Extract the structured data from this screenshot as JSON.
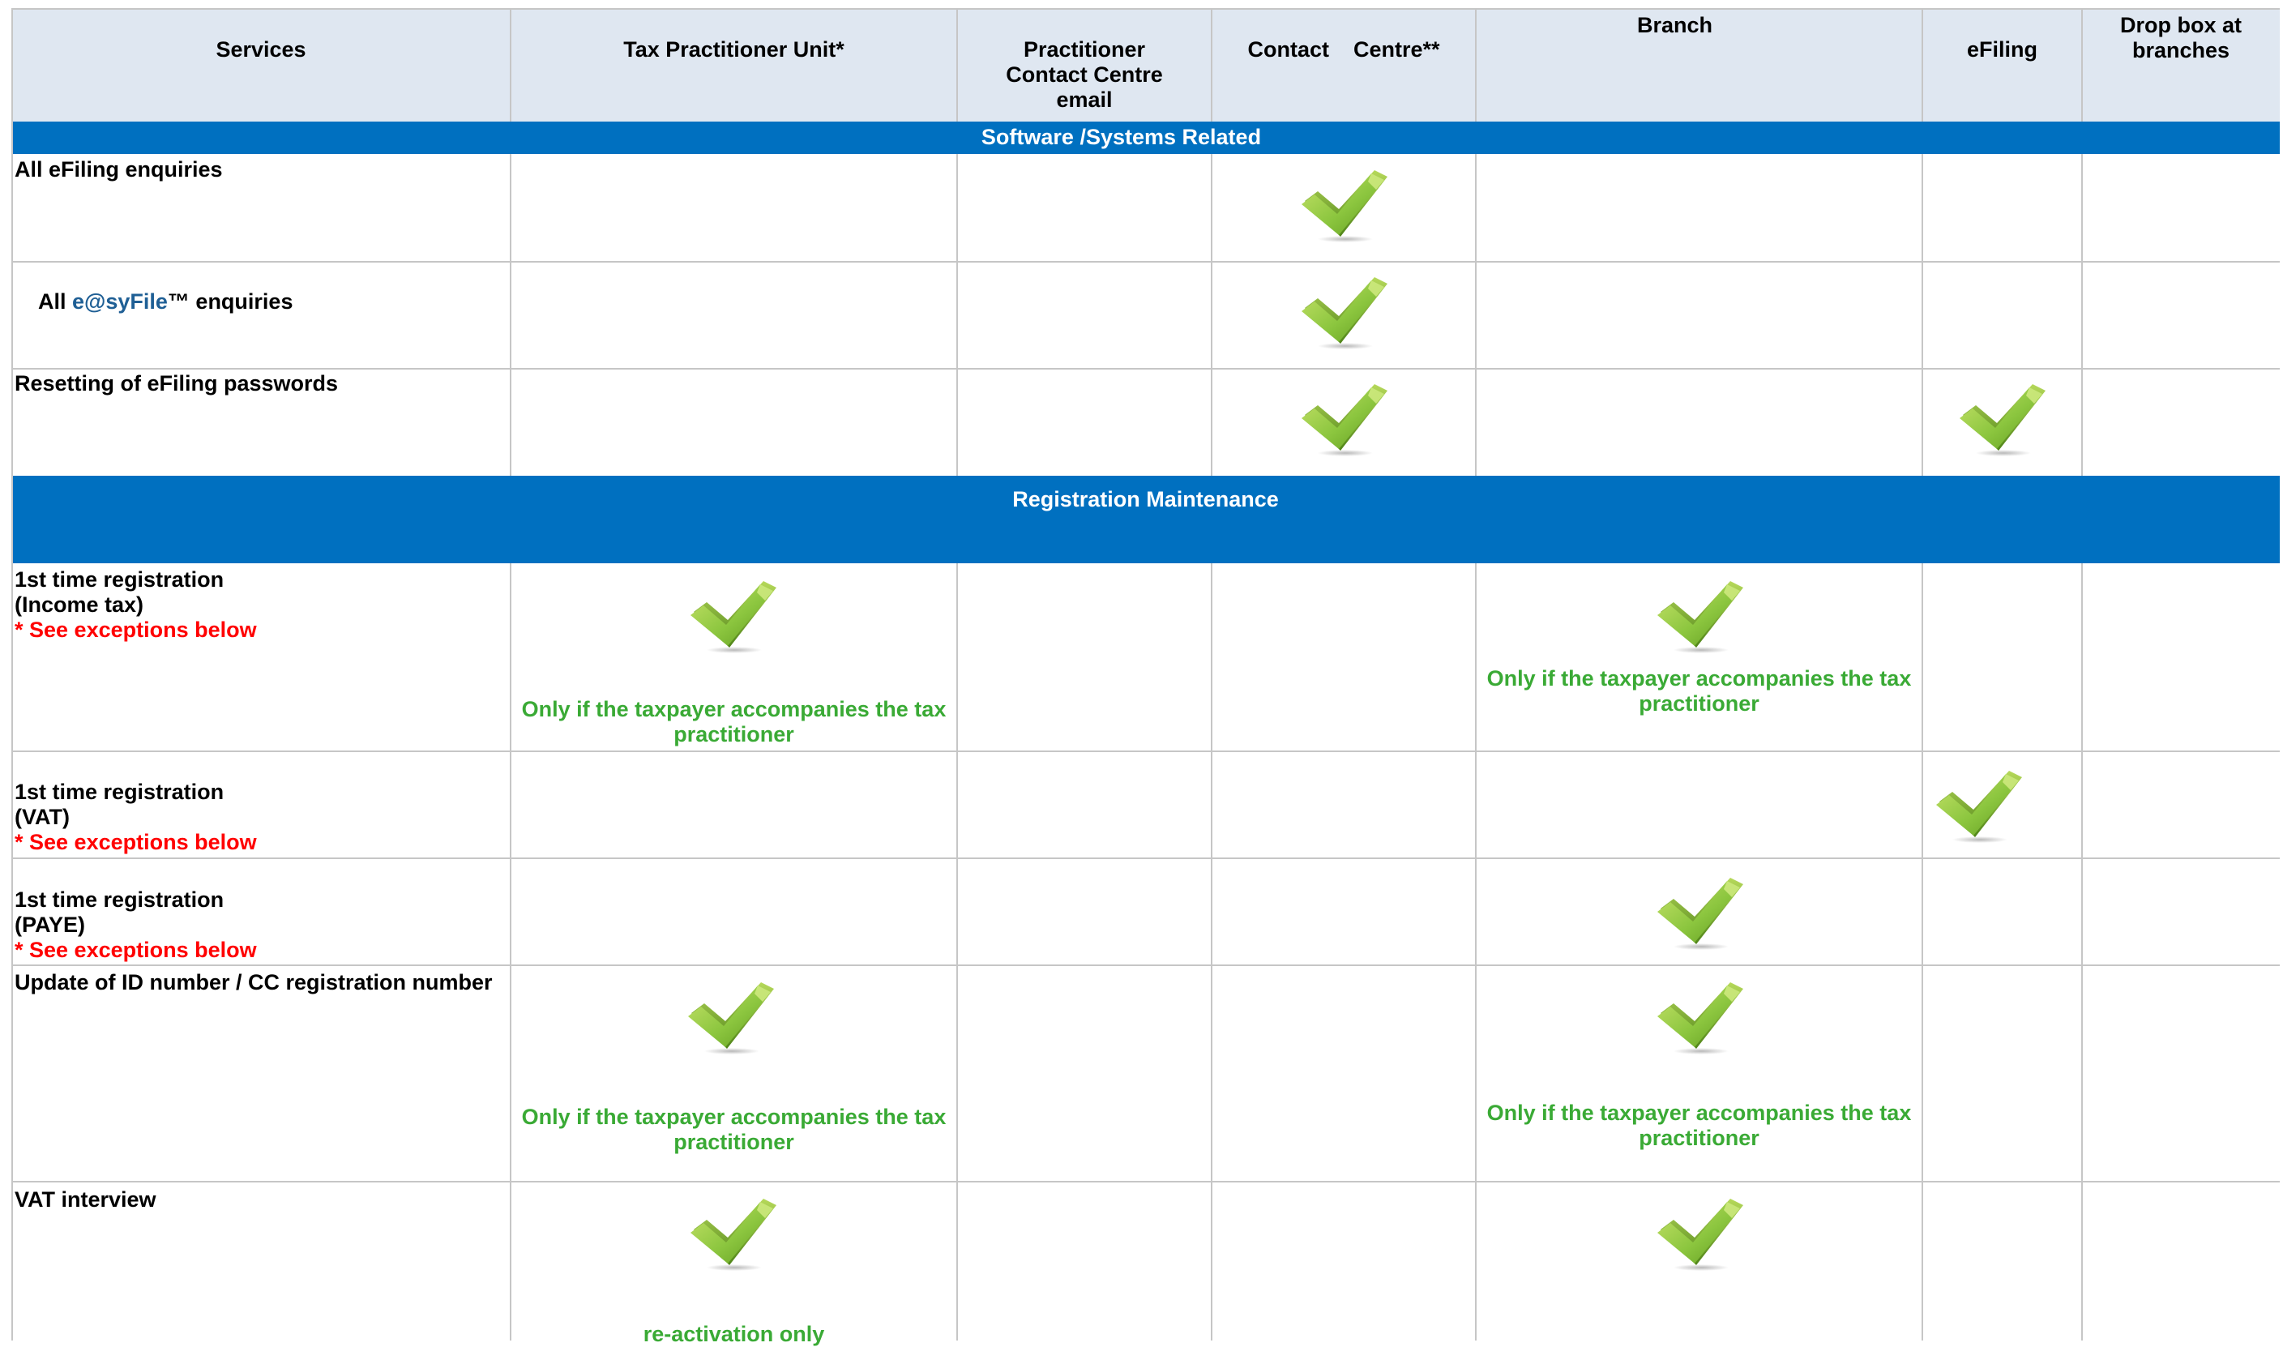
{
  "header": {
    "services": "Services",
    "tax_practitioner_unit": "Tax Practitioner Unit*",
    "practitioner_email": [
      "Practitioner",
      "Contact Centre",
      "email"
    ],
    "contact_centre": "Contact    Centre**",
    "branch": "Branch",
    "efiling": "eFiling",
    "drop_box": [
      "Drop box at",
      "branches"
    ]
  },
  "sections": {
    "software": "Software /Systems Related",
    "registration": "Registration Maintenance"
  },
  "rows": {
    "efiling_enquiries": "All eFiling enquiries",
    "easyfile_prefix": "All ",
    "easyfile_brand": "e@syFile",
    "easyfile_suffix": "™ enquiries",
    "reset_passwords": "Resetting of eFiling passwords",
    "reg_income_line1": "1st time registration",
    "reg_income_line2": "(Income tax)",
    "reg_vat_line1": "1st time registration",
    "reg_vat_line2": "(VAT)",
    "reg_paye_line1": "1st time registration",
    "reg_paye_line2": "(PAYE)",
    "exceptions": "* See exceptions below",
    "update_id": "Update of ID number / CC registration number",
    "vat_interview": "VAT interview"
  },
  "notes": {
    "accompanies_line1": "Only if the taxpayer accompanies the tax",
    "accompanies_line2": "practitioner",
    "reactivation": "re-activation only"
  },
  "colors": {
    "header_bg": "#dfe7f1",
    "section_band": "#0070c0",
    "tick_green": "#8cc63f",
    "note_green": "#3aaa35",
    "exception_red": "#ff0000",
    "brand_blue": "#1f5f95"
  },
  "icons": {
    "availability": "check-mark-icon"
  }
}
